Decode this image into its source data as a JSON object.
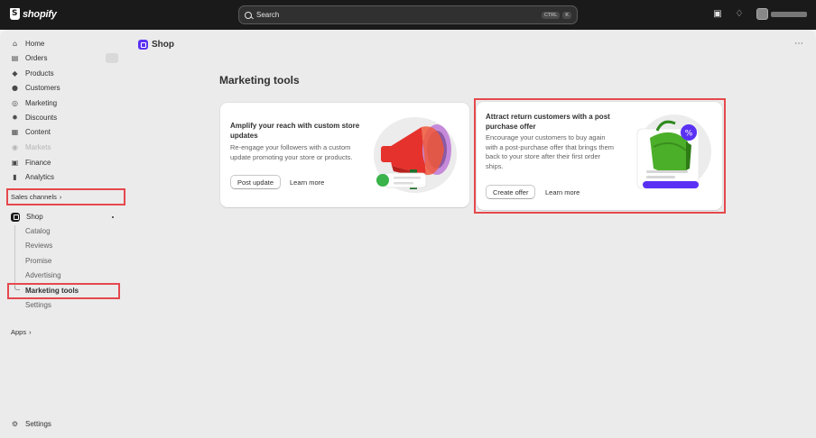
{
  "topbar": {
    "brand": "shopify",
    "search_placeholder": "Search",
    "shortcut_keys": [
      "CTRL",
      "K"
    ]
  },
  "sidebar": {
    "items": [
      {
        "label": "Home",
        "icon": "home-icon"
      },
      {
        "label": "Orders",
        "icon": "orders-icon"
      },
      {
        "label": "Products",
        "icon": "tag-icon"
      },
      {
        "label": "Customers",
        "icon": "person-icon"
      },
      {
        "label": "Marketing",
        "icon": "target-icon"
      },
      {
        "label": "Discounts",
        "icon": "discount-icon"
      },
      {
        "label": "Content",
        "icon": "content-icon"
      },
      {
        "label": "Markets",
        "icon": "globe-icon",
        "disabled": true
      },
      {
        "label": "Finance",
        "icon": "bank-icon"
      },
      {
        "label": "Analytics",
        "icon": "bar-chart-icon"
      }
    ],
    "sales_channels_label": "Sales channels",
    "shop_label": "Shop",
    "shop_subitems": [
      "Catalog",
      "Reviews",
      "Promise",
      "Advertising",
      "Marketing tools",
      "Settings"
    ],
    "apps_label": "Apps",
    "settings_label": "Settings"
  },
  "header": {
    "title": "Shop"
  },
  "main": {
    "section_title": "Marketing tools",
    "cards": [
      {
        "title": "Amplify your reach with custom store updates",
        "description": "Re-engage your followers with a custom update promoting your store or products.",
        "primary_button": "Post update",
        "secondary_link": "Learn more",
        "illustration": "megaphone-icon"
      },
      {
        "title": "Attract return customers with a post purchase offer",
        "description": "Encourage your customers to buy again with a post-purchase offer that brings them back to your store after their first order ships.",
        "primary_button": "Create offer",
        "secondary_link": "Learn more",
        "illustration": "shopping-bag-discount-icon"
      }
    ]
  },
  "colors": {
    "topbar": "#1a1a1a",
    "highlight_box": "#e5484d",
    "shop_purple": "#5a31f4",
    "megaphone_red": "#e5322d",
    "bag_green": "#4caf2a"
  }
}
